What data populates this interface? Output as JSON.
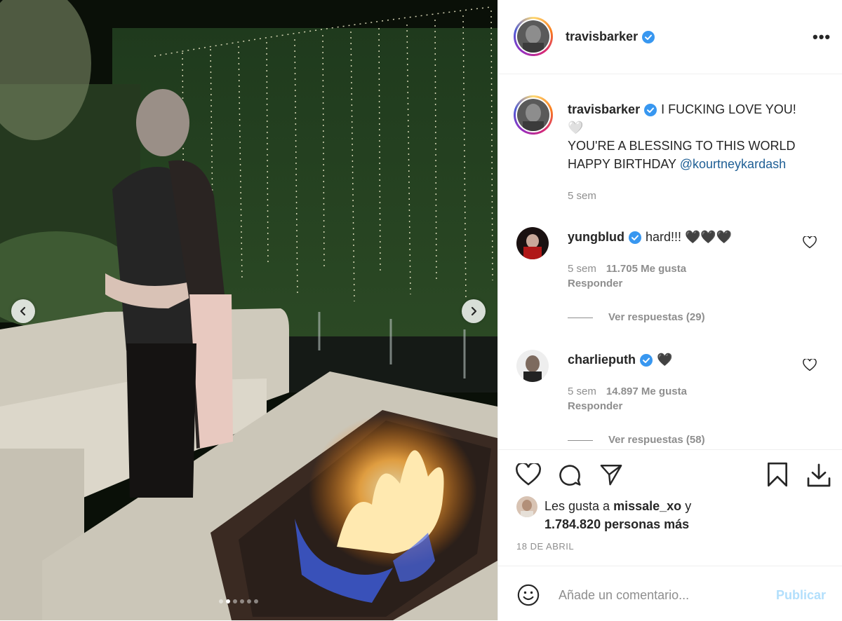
{
  "post": {
    "author": "travisbarker",
    "caption_lines": [
      "I FUCKING LOVE YOU!",
      "🤍",
      "YOU'RE A BLESSING TO THIS WORLD",
      "HAPPY BIRTHDAY"
    ],
    "caption_mention": "@kourtneykardash",
    "caption_time": "5 sem",
    "carousel_index": 2,
    "carousel_count": 6
  },
  "comments": [
    {
      "user": "yungblud",
      "text": "hard!!! 🖤🖤🖤",
      "time": "5 sem",
      "likes": "11.705 Me gusta",
      "reply_label": "Responder",
      "view_replies": "Ver respuestas (29)"
    },
    {
      "user": "charlieputh",
      "text": "🖤",
      "time": "5 sem",
      "likes": "14.897 Me gusta",
      "reply_label": "Responder",
      "view_replies": "Ver respuestas (58)"
    }
  ],
  "likes": {
    "prefix": "Les gusta a",
    "user": "missale_xo",
    "conj": "y",
    "others": "1.784.820 personas más"
  },
  "date": "18 DE ABRIL",
  "composer": {
    "placeholder": "Añade un comentario...",
    "publish_label": "Publicar"
  },
  "colors": {
    "verified": "#3897f0",
    "link": "#1f5f95",
    "publish_disabled": "#b2dffc"
  },
  "icons": [
    "more-icon",
    "verified-icon",
    "heart-icon",
    "comment-icon",
    "share-icon",
    "bookmark-icon",
    "download-icon",
    "emoji-icon",
    "chevron-left-icon",
    "chevron-right-icon"
  ]
}
